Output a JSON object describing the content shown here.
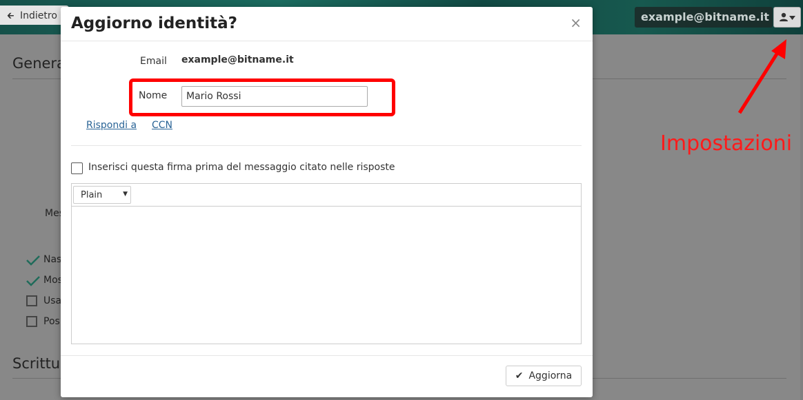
{
  "topbar": {
    "back_label": "Indietro",
    "account_email": "example@bitname.it",
    "settings_icon": "user-caret-icon"
  },
  "background_page": {
    "section_general_partial": "Genera",
    "section_writing_partial": "Scrittu",
    "label_partial": "Mes",
    "options_partial": [
      "Nas",
      "Mos",
      "Usa",
      "Pos"
    ],
    "options_checked": [
      true,
      true,
      false,
      false
    ]
  },
  "modal": {
    "title": "Aggiorno identità?",
    "close_symbol": "×",
    "email_label": "Email",
    "email_value": "example@bitname.it",
    "name_label": "Nome",
    "name_value": "Mario Rossi",
    "reply_to_link": "Rispondi a",
    "bcc_link": "CCN",
    "signature_checkbox_label": "Inserisci questa firma prima del messaggio citato nelle risposte",
    "signature_checkbox_checked": false,
    "editor_mode": "Plain",
    "editor_content": "",
    "update_button": "Aggiorna"
  },
  "annotation": {
    "text": "Impostazioni",
    "color": "#ff0000"
  }
}
